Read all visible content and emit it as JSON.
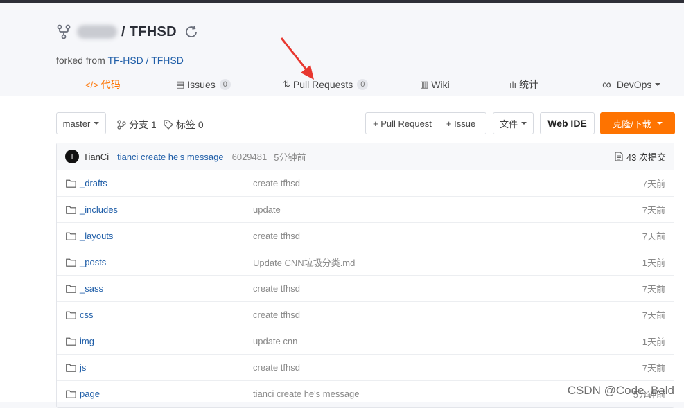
{
  "repo": {
    "name": "/ TFHSD",
    "forked_prefix": "forked from ",
    "forked_owner": "TF-HSD",
    "forked_sep": " / ",
    "forked_repo": "TFHSD"
  },
  "tabs": [
    {
      "icon": "</>",
      "label": "代码"
    },
    {
      "icon": "▤",
      "label": "Issues",
      "count": "0"
    },
    {
      "icon": "⇅",
      "label": "Pull Requests",
      "count": "0"
    },
    {
      "icon": "▥",
      "label": "Wiki"
    },
    {
      "icon": "ılı",
      "label": "统计"
    },
    {
      "icon": "∞",
      "label": "DevOps"
    }
  ],
  "toolbar": {
    "branch": "master",
    "branches_label": "分支 1",
    "tags_label": "标签 0",
    "pull_request": "+ Pull Request",
    "issue": "+ Issue",
    "file": "文件",
    "web_ide": "Web IDE",
    "clone": "克隆/下载"
  },
  "commit": {
    "avatar": "T",
    "author": "TianCi",
    "message": "tianci create he's message",
    "hash": "6029481",
    "time": "5分钟前",
    "total": "43 次提交"
  },
  "files": [
    {
      "name": "_drafts",
      "message": "create tfhsd",
      "time": "7天前"
    },
    {
      "name": "_includes",
      "message": "update",
      "time": "7天前"
    },
    {
      "name": "_layouts",
      "message": "create tfhsd",
      "time": "7天前"
    },
    {
      "name": "_posts",
      "message": "Update CNN垃圾分类.md",
      "time": "1天前"
    },
    {
      "name": "_sass",
      "message": "create tfhsd",
      "time": "7天前"
    },
    {
      "name": "css",
      "message": "create tfhsd",
      "time": "7天前"
    },
    {
      "name": "img",
      "message": "update cnn",
      "time": "1天前"
    },
    {
      "name": "js",
      "message": "create tfhsd",
      "time": "7天前"
    },
    {
      "name": "page",
      "message": "tianci create he's message",
      "time": "5分钟前"
    }
  ],
  "watermark": "CSDN @Code_Bald",
  "colors": {
    "accent": "#fe7300",
    "link": "#1f5ea8",
    "annotation_arrow": "#e8372f"
  }
}
